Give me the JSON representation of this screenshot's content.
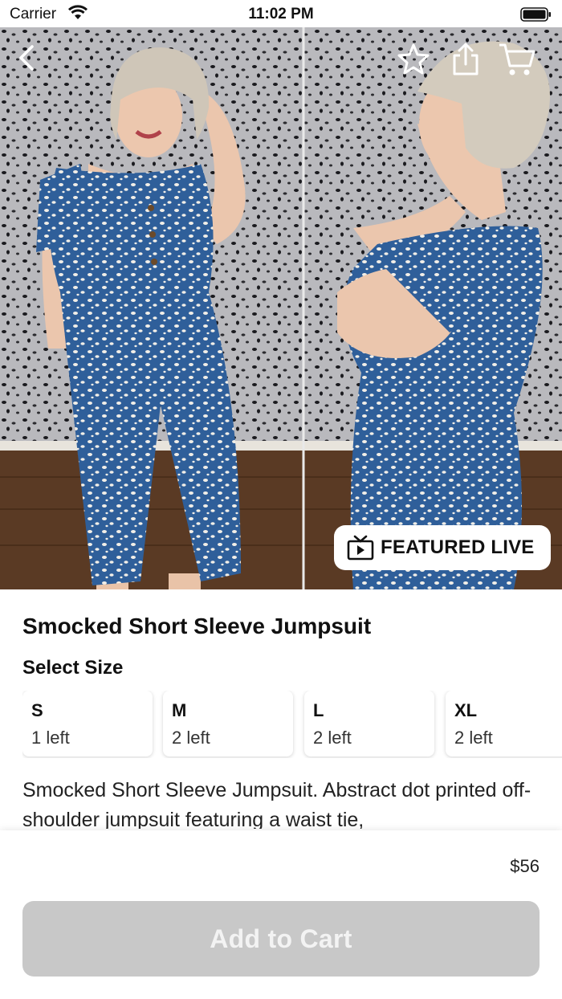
{
  "status_bar": {
    "carrier": "Carrier",
    "time": "11:02 PM"
  },
  "nav": {
    "back": "chevron-left-icon",
    "favorite": "star-icon",
    "share": "share-icon",
    "cart": "cart-icon"
  },
  "badge": {
    "label": "FEATURED LIVE",
    "icon": "tv-play-icon"
  },
  "product": {
    "title": "Smocked Short Sleeve Jumpsuit",
    "select_size_label": "Select Size",
    "sizes": [
      {
        "code": "S",
        "stock": "1 left"
      },
      {
        "code": "M",
        "stock": "2 left"
      },
      {
        "code": "L",
        "stock": "2 left"
      },
      {
        "code": "XL",
        "stock": "2 left"
      }
    ],
    "description": "Smocked Short Sleeve Jumpsuit. Abstract dot printed off-shoulder jumpsuit featuring a waist tie,",
    "price": "$56"
  },
  "actions": {
    "add_to_cart": "Add to Cart"
  },
  "colors": {
    "button_disabled": "#c8c8c8",
    "jumpsuit_blue": "#2f5f9a"
  }
}
